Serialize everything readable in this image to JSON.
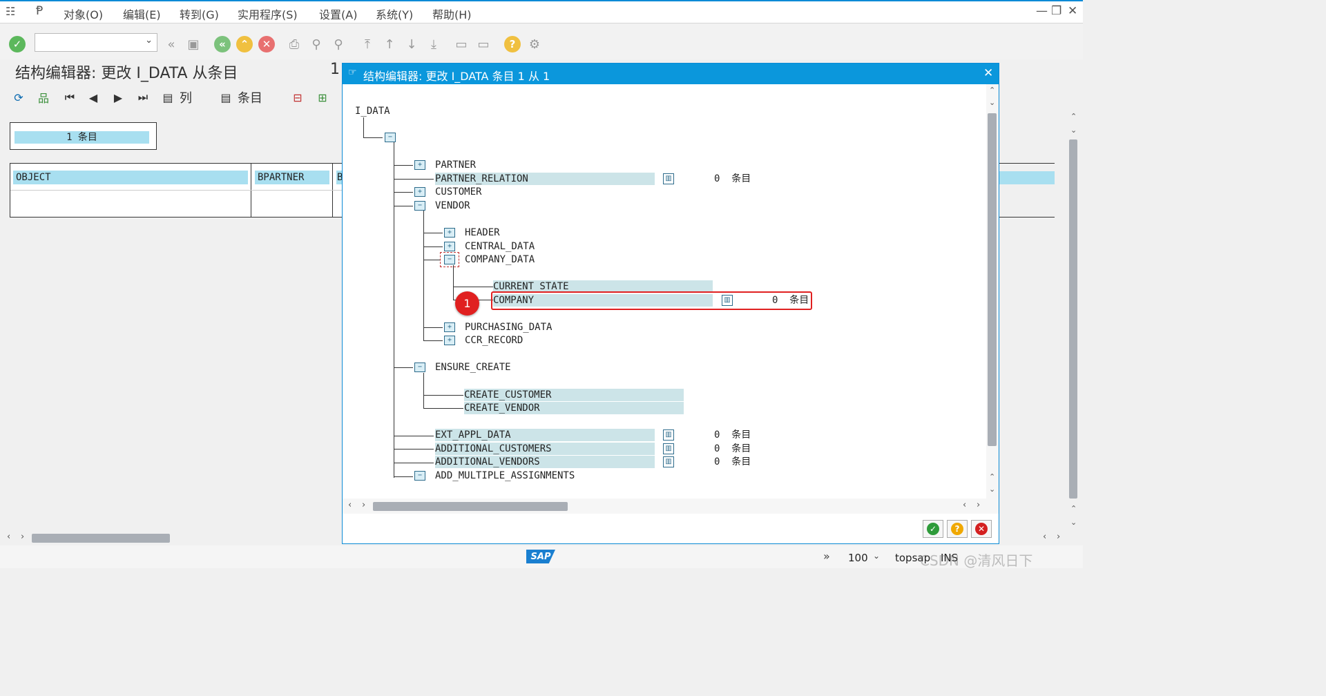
{
  "menu": {
    "items": [
      "对象(O)",
      "编辑(E)",
      "转到(G)",
      "实用程序(S)",
      "设置(A)",
      "系统(Y)",
      "帮助(H)"
    ],
    "menu_icon": "menu-icon",
    "p_icon": "sap-menu-icon"
  },
  "window_controls": {
    "minimize": "—",
    "restore": "❐",
    "close": "✕"
  },
  "toolbar": {
    "command_value": ""
  },
  "screen": {
    "title": "结构编辑器: 更改 I_DATA 从条目",
    "title_fragment": "1",
    "columns_label": "列",
    "entries_label": "条目",
    "count_text": "1  条目"
  },
  "grid": {
    "columns": [
      "OBJECT",
      "BPARTNER",
      "B"
    ]
  },
  "dialog": {
    "title": "结构编辑器: 更改 I_DATA 条目 1 从 1",
    "root": "I_DATA",
    "nodes": {
      "partner": "PARTNER",
      "partner_relation": "PARTNER_RELATION",
      "customer": "CUSTOMER",
      "vendor": "VENDOR",
      "header": "HEADER",
      "central_data": "CENTRAL_DATA",
      "company_data": "COMPANY_DATA",
      "current_state": "CURRENT_STATE",
      "company": "COMPANY",
      "purchasing_data": "PURCHASING_DATA",
      "ccr_record": "CCR_RECORD",
      "ensure_create": "ENSURE_CREATE",
      "create_customer": "CREATE_CUSTOMER",
      "create_vendor": "CREATE_VENDOR",
      "ext_appl_data": "EXT_APPL_DATA",
      "additional_customers": "ADDITIONAL_CUSTOMERS",
      "additional_vendors": "ADDITIONAL_VENDORS",
      "add_multiple_assignments": "ADD_MULTIPLE_ASSIGNMENTS"
    },
    "count_text": "0  条目",
    "annotation_number": "1",
    "colors": {
      "title_bar": "#0b97dc",
      "annotation": "#e02020",
      "highlight": "#cce4e8"
    }
  },
  "status": {
    "zoom": "100",
    "system": "topsap",
    "mode": "INS",
    "logo": "SAP",
    "watermark": "CSDN @清风日下"
  }
}
